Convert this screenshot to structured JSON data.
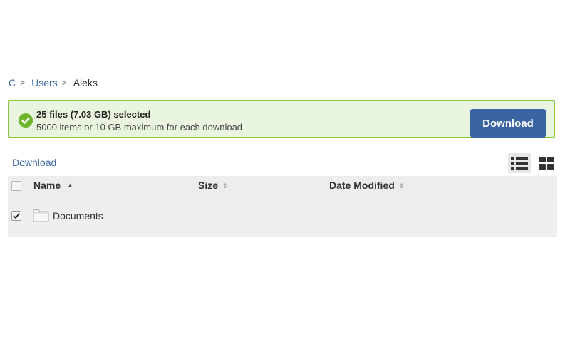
{
  "breadcrumb": {
    "items": [
      "C",
      "Users"
    ],
    "separator": ">",
    "current": "Aleks"
  },
  "banner": {
    "title": "25 files (7.03 GB) selected",
    "subtitle": "5000 items or 10 GB maximum for each download",
    "button_label": "Download",
    "accent_color": "#8cc63f",
    "button_color": "#3b64a3"
  },
  "toolbar": {
    "download_link": "Download",
    "views": [
      {
        "icon": "list-view-icon",
        "active": true
      },
      {
        "icon": "grid-view-icon",
        "active": false
      }
    ]
  },
  "table": {
    "columns": [
      {
        "label": "Name",
        "sort": "ascending"
      },
      {
        "label": "Size",
        "sort": "none"
      },
      {
        "label": "Date Modified",
        "sort": "none"
      }
    ],
    "rows": [
      {
        "name": "Documents",
        "type": "folder",
        "checked": true
      }
    ]
  }
}
